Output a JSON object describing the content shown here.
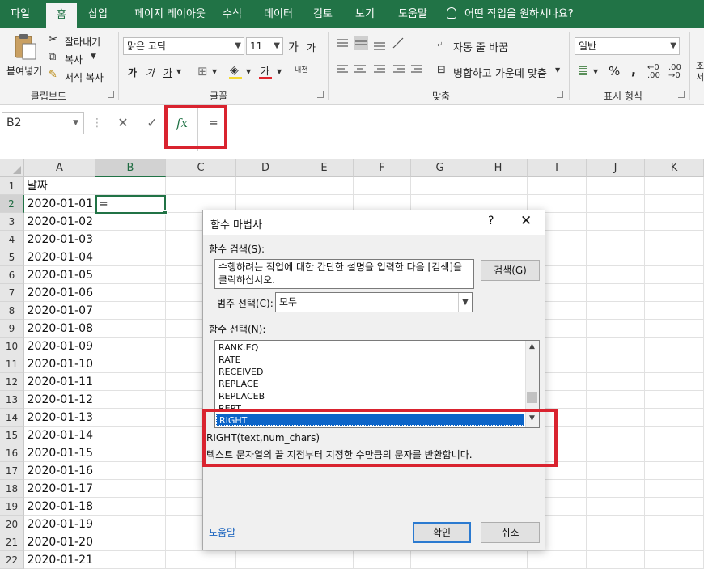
{
  "ribbon_tabs": [
    "파일",
    "홈",
    "삽입",
    "페이지 레이아웃",
    "수식",
    "데이터",
    "검토",
    "보기",
    "도움말"
  ],
  "active_tab": "홈",
  "tell_me": "어떤 작업을 원하시나요?",
  "clipboard": {
    "paste": "붙여넣기",
    "cut": "잘라내기",
    "copy": "복사",
    "format_painter": "서식 복사",
    "label": "클립보드"
  },
  "font": {
    "name": "맑은 고딕",
    "size": "11",
    "grow": "가",
    "shrink": "가",
    "bold": "가",
    "italic": "가",
    "underline": "가",
    "font_color": "가",
    "phonetic": "내천",
    "label": "글꼴"
  },
  "alignment": {
    "wrap_text": "자동 줄 바꿈",
    "merge_center": "병합하고 가운데 맞춤",
    "label": "맞춤"
  },
  "number": {
    "format": "일반",
    "percent": "%",
    "comma": ",",
    "label": "표시 형식"
  },
  "styles_partial": "조건\n서",
  "formula_bar": {
    "name_box": "B2",
    "cancel": "✕",
    "enter": "✓",
    "fx": "fx",
    "value": "="
  },
  "sheet": {
    "columns": [
      "A",
      "B",
      "C",
      "D",
      "E",
      "F",
      "G",
      "H",
      "I",
      "J",
      "K"
    ],
    "selected_column": "B",
    "rows": [
      "1",
      "2",
      "3",
      "4",
      "5",
      "6",
      "7",
      "8",
      "9",
      "10",
      "11",
      "12",
      "13",
      "14",
      "15",
      "16",
      "17",
      "18",
      "19",
      "20",
      "21",
      "22"
    ],
    "selected_row": "2",
    "header_a1": "날짜",
    "dates": [
      "2020-01-01",
      "2020-01-02",
      "2020-01-03",
      "2020-01-04",
      "2020-01-05",
      "2020-01-06",
      "2020-01-07",
      "2020-01-08",
      "2020-01-09",
      "2020-01-10",
      "2020-01-11",
      "2020-01-12",
      "2020-01-13",
      "2020-01-14",
      "2020-01-15",
      "2020-01-16",
      "2020-01-17",
      "2020-01-18",
      "2020-01-19",
      "2020-01-20",
      "2020-01-21"
    ],
    "b2_value": "="
  },
  "dialog": {
    "title": "함수 마법사",
    "help_q": "?",
    "close": "✕",
    "search_label": "함수 검색(S):",
    "search_text": "수행하려는 작업에 대한 간단한 설명을 입력한 다음 [검색]을 클릭하십시오.",
    "search_button": "검색(G)",
    "category_label": "범주 선택(C):",
    "category_value": "모두",
    "function_list_label": "함수 선택(N):",
    "functions": [
      "RANK.EQ",
      "RATE",
      "RECEIVED",
      "REPLACE",
      "REPLACEB",
      "REPT",
      "RIGHT"
    ],
    "selected_function": "RIGHT",
    "signature": "RIGHT(text,num_chars)",
    "description": "텍스트 문자열의 끝 지점부터 지정한 수만큼의 문자를 반환합니다.",
    "help_link": "도움말",
    "ok": "확인",
    "cancel": "취소"
  },
  "colors": {
    "excel_green": "#217346",
    "highlight_red": "#d9232f",
    "selection_blue": "#0c64c8"
  }
}
